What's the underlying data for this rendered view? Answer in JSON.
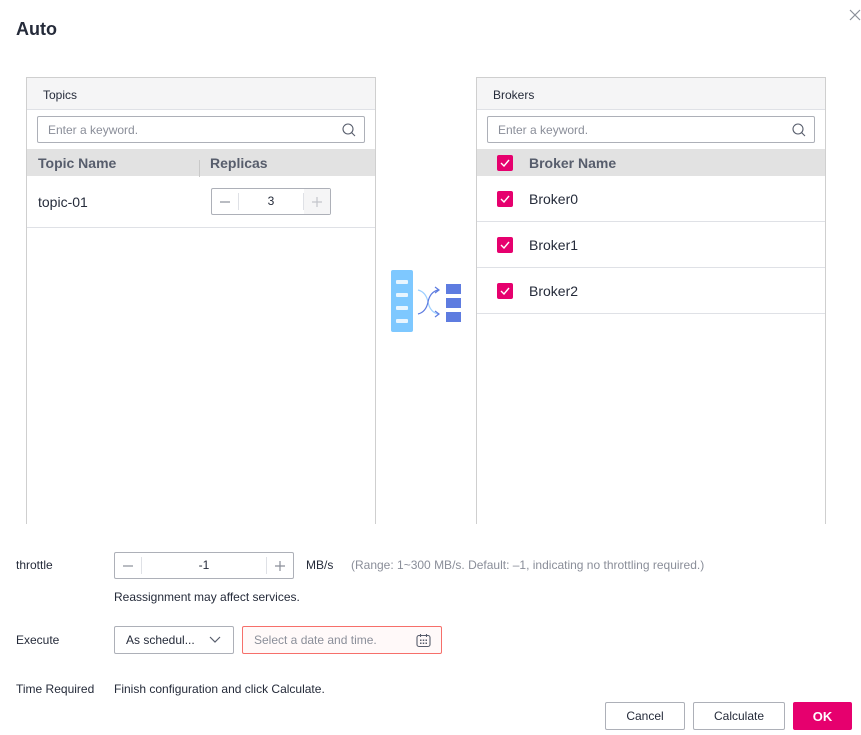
{
  "dialog": {
    "title": "Auto",
    "close_icon": "close-icon"
  },
  "topics_panel": {
    "title": "Topics",
    "search_placeholder": "Enter a keyword.",
    "columns": [
      "Topic Name",
      "Replicas"
    ],
    "rows": [
      {
        "topic_name": "topic-01",
        "replicas": "3"
      }
    ]
  },
  "brokers_panel": {
    "title": "Brokers",
    "search_placeholder": "Enter a keyword.",
    "header": {
      "label": "Broker Name",
      "checked": true
    },
    "rows": [
      {
        "name": "Broker0",
        "checked": true
      },
      {
        "name": "Broker1",
        "checked": true
      },
      {
        "name": "Broker2",
        "checked": true
      }
    ]
  },
  "form": {
    "throttle": {
      "label": "throttle",
      "value": "-1",
      "unit": "MB/s",
      "hint": "(Range: 1~300 MB/s. Default: –1, indicating no throttling required.)",
      "note": "Reassignment may affect services."
    },
    "execute": {
      "label": "Execute",
      "selected": "As schedul...",
      "date_placeholder": "Select a date and time."
    },
    "time_required": {
      "label": "Time Required",
      "value": "Finish configuration and click Calculate."
    }
  },
  "footer": {
    "cancel_label": "Cancel",
    "calculate_label": "Calculate",
    "ok_label": "OK"
  },
  "colors": {
    "accent": "#e6006e",
    "error_border": "#f66f6a",
    "transfer_icon_light": "#7ec8ff",
    "transfer_icon_dark": "#5e7ce0"
  }
}
